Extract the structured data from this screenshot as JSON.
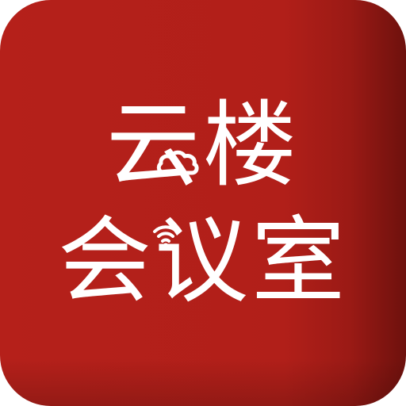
{
  "icon": {
    "line1": "云楼",
    "line2": "会议室",
    "background_color": "#b11f19",
    "text_color": "#ffffff",
    "decor_icons": [
      "cloud-icon",
      "wifi-icon"
    ]
  }
}
